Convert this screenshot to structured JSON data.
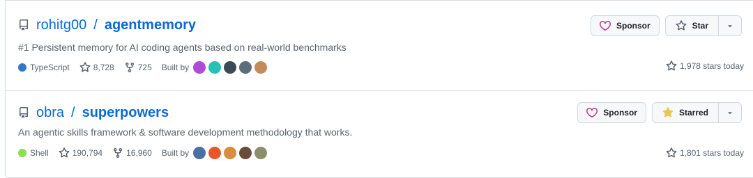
{
  "repos": [
    {
      "owner": "rohitg00",
      "slash": "/",
      "name": "agentmemory",
      "description": "#1 Persistent memory for AI coding agents based on real-world benchmarks",
      "language": "TypeScript",
      "language_color": "#3178c6",
      "stars": "8,728",
      "forks": "725",
      "built_by_label": "Built by",
      "sponsor_label": "Sponsor",
      "star_label": "Star",
      "starred": false,
      "stars_today": "1,978 stars today",
      "avatar_colors": [
        "#b04bd6",
        "#26c1b5",
        "#3b4a55",
        "#5b6e7a",
        "#c48a5a"
      ]
    },
    {
      "owner": "obra",
      "slash": "/",
      "name": "superpowers",
      "description": "An agentic skills framework & software development methodology that works.",
      "language": "Shell",
      "language_color": "#89e051",
      "stars": "190,794",
      "forks": "16,960",
      "built_by_label": "Built by",
      "sponsor_label": "Sponsor",
      "star_label": "Starred",
      "starred": true,
      "stars_today": "1,801 stars today",
      "avatar_colors": [
        "#4a6fa5",
        "#e8572a",
        "#d98c3a",
        "#6b4c3b",
        "#8b8f6a"
      ]
    }
  ],
  "colors": {
    "link": "#0969da",
    "sponsor_heart": "#bf3989",
    "starred_star": "#eac54f"
  }
}
